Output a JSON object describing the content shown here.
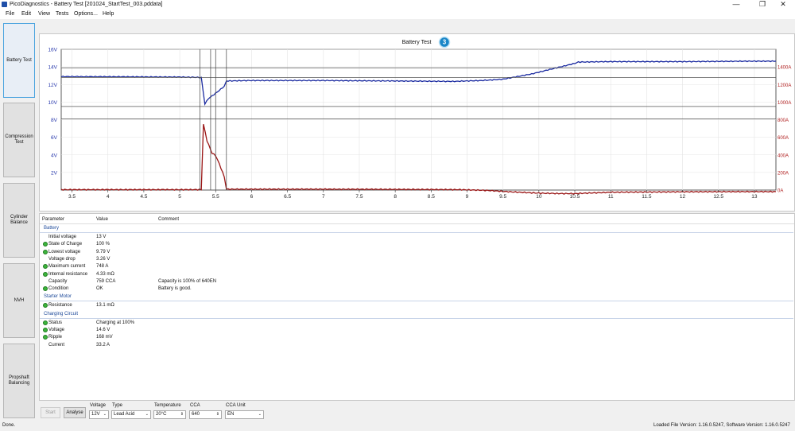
{
  "window": {
    "title": "PicoDiagnostics - Battery Test [201024_StartTest_003.pddata]",
    "controls": [
      "—",
      "❐",
      "✕"
    ]
  },
  "menu": [
    "File",
    "Edit",
    "View",
    "Tests",
    "Options...",
    "Help"
  ],
  "sidebar": [
    {
      "label": "Battery Test",
      "active": true
    },
    {
      "label": "Compression Test",
      "active": false
    },
    {
      "label": "Cylinder Balance",
      "active": false
    },
    {
      "label": "NVH",
      "active": false
    },
    {
      "label": "Propshaft Balancing",
      "active": false
    }
  ],
  "chart_title": "Battery Test",
  "chart_badge": "3",
  "chart_data": {
    "type": "line",
    "title": "Battery Test",
    "x_range": [
      3.35,
      13.3
    ],
    "x_ticks": [
      "3.5",
      "4",
      "4.5",
      "5",
      "5.5",
      "6",
      "6.5",
      "7",
      "7.5",
      "8",
      "8.5",
      "9",
      "9.5",
      "10",
      "10.5",
      "11",
      "11.5",
      "12",
      "12.5",
      "13"
    ],
    "y_left": {
      "range": [
        0,
        16
      ],
      "ticks": [
        "2V",
        "4V",
        "6V",
        "8V",
        "10V",
        "12V",
        "14V",
        "16V"
      ],
      "color": "#2233aa"
    },
    "y_right": {
      "range": [
        0,
        1600
      ],
      "ticks": [
        "0A",
        "200A",
        "400A",
        "600A",
        "800A",
        "1000A",
        "1200A",
        "1400A"
      ],
      "color": "#b02020"
    },
    "series": [
      {
        "axis": "left",
        "color": "#1a2aa0",
        "points": [
          [
            3.35,
            12.9
          ],
          [
            5.0,
            12.85
          ],
          [
            5.3,
            12.8
          ],
          [
            5.35,
            9.8
          ],
          [
            5.4,
            10.4
          ],
          [
            5.5,
            11.0
          ],
          [
            5.62,
            11.8
          ],
          [
            5.65,
            12.4
          ],
          [
            6.0,
            12.45
          ],
          [
            7.0,
            12.45
          ],
          [
            8.0,
            12.4
          ],
          [
            8.8,
            12.35
          ],
          [
            9.2,
            12.45
          ],
          [
            9.5,
            12.6
          ],
          [
            9.9,
            13.2
          ],
          [
            10.2,
            13.8
          ],
          [
            10.5,
            14.4
          ],
          [
            10.55,
            14.55
          ],
          [
            11.0,
            14.6
          ],
          [
            12.0,
            14.6
          ],
          [
            13.0,
            14.65
          ],
          [
            13.3,
            14.65
          ]
        ]
      },
      {
        "axis": "right",
        "color": "#9a1515",
        "points": [
          [
            3.35,
            5
          ],
          [
            5.3,
            5
          ],
          [
            5.33,
            748
          ],
          [
            5.38,
            560
          ],
          [
            5.45,
            420
          ],
          [
            5.5,
            390
          ],
          [
            5.55,
            300
          ],
          [
            5.62,
            150
          ],
          [
            5.65,
            10
          ],
          [
            6.0,
            10
          ],
          [
            7.0,
            10
          ],
          [
            8.0,
            8
          ],
          [
            8.9,
            5
          ],
          [
            9.3,
            -5
          ],
          [
            9.6,
            -20
          ],
          [
            10.0,
            -35
          ],
          [
            10.3,
            -40
          ],
          [
            10.5,
            -40
          ],
          [
            11.0,
            -25
          ],
          [
            12.0,
            -20
          ],
          [
            13.0,
            -18
          ],
          [
            13.3,
            -18
          ]
        ]
      }
    ]
  },
  "results": {
    "headers": {
      "parameter": "Parameter",
      "value": "Value",
      "comment": "Comment"
    },
    "sections": [
      {
        "name": "Battery",
        "rows": [
          {
            "indicator": false,
            "name": "Initial voltage",
            "value": "13 V",
            "comment": ""
          },
          {
            "indicator": true,
            "name": "State of Charge",
            "value": "100 %",
            "comment": ""
          },
          {
            "indicator": true,
            "name": "Lowest voltage",
            "value": "9.79 V",
            "comment": ""
          },
          {
            "indicator": false,
            "name": "Voltage drop",
            "value": "3.26 V",
            "comment": ""
          },
          {
            "indicator": true,
            "name": "Maximum current",
            "value": "748 A",
            "comment": ""
          },
          {
            "indicator": true,
            "name": "Internal resistance",
            "value": "4.33 mΩ",
            "comment": ""
          },
          {
            "indicator": false,
            "name": "Capacity",
            "value": "759 CCA",
            "comment": "Capacity is 100% of 640EN"
          },
          {
            "indicator": true,
            "name": "Condition",
            "value": "OK",
            "comment": "Battery is good."
          }
        ]
      },
      {
        "name": "Starter Motor",
        "rows": [
          {
            "indicator": true,
            "name": "Resistance",
            "value": "13.1 mΩ",
            "comment": ""
          }
        ]
      },
      {
        "name": "Charging Circuit",
        "rows": [
          {
            "indicator": true,
            "name": "Status",
            "value": "Charging at 100%",
            "comment": ""
          },
          {
            "indicator": true,
            "name": "Voltage",
            "value": "14.6 V",
            "comment": ""
          },
          {
            "indicator": true,
            "name": "Ripple",
            "value": "168 mV",
            "comment": ""
          },
          {
            "indicator": false,
            "name": "Current",
            "value": "33.2 A",
            "comment": ""
          }
        ]
      }
    ]
  },
  "bottom": {
    "start_label": "Start",
    "analyse_label": "Analyse",
    "voltage_label": "Voltage",
    "voltage_value": "12V",
    "type_label": "Type",
    "type_value": "Lead Acid",
    "temperature_label": "Temperature",
    "temperature_value": "20°C",
    "cca_label": "CCA",
    "cca_value": "640",
    "cca_unit_label": "CCA Unit",
    "cca_unit_value": "EN"
  },
  "status": {
    "left": "Done.",
    "right": "Loaded File Version: 1.16.0.5247,  Software Version: 1.16.0.5247"
  }
}
